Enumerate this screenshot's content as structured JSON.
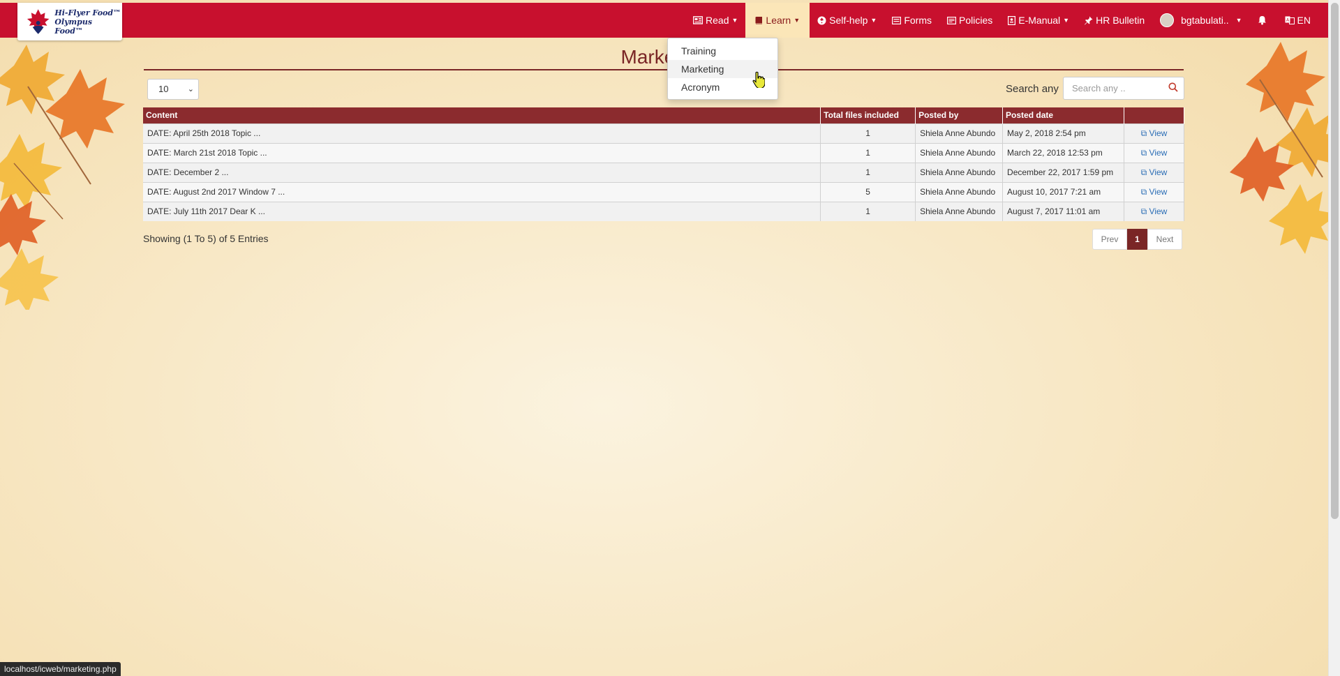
{
  "brand": {
    "line1": "Hi-Flyer Food™",
    "line2": "Olympus Food™"
  },
  "nav": {
    "read": "Read",
    "learn": "Learn",
    "selfhelp": "Self-help",
    "forms": "Forms",
    "policies": "Policies",
    "emanual": "E-Manual",
    "hrbulletin": "HR Bulletin",
    "user": "bgtabulati..",
    "lang": "EN"
  },
  "dropdown": {
    "items": [
      "Training",
      "Marketing",
      "Acronym"
    ]
  },
  "page": {
    "title": "Marketing"
  },
  "controls": {
    "page_length": "10",
    "search_label": "Search any",
    "search_placeholder": "Search any .."
  },
  "table": {
    "headers": [
      "Content",
      "Total files included",
      "Posted by",
      "Posted date",
      ""
    ],
    "rows": [
      {
        "content": "DATE: April 25th 2018   Topic ...",
        "files": "1",
        "by": "Shiela Anne Abundo",
        "date": "May 2, 2018 2:54 pm",
        "action": "View"
      },
      {
        "content": "DATE: March 21st 2018   Topic ...",
        "files": "1",
        "by": "Shiela Anne Abundo",
        "date": "March 22, 2018 12:53 pm",
        "action": "View"
      },
      {
        "content": "DATE:  December 2 ...",
        "files": "1",
        "by": "Shiela Anne Abundo",
        "date": "December 22, 2017 1:59 pm",
        "action": "View"
      },
      {
        "content": "DATE: August 2nd 2017  Window 7 ...",
        "files": "5",
        "by": "Shiela Anne Abundo",
        "date": "August 10, 2017 7:21 am",
        "action": "View"
      },
      {
        "content": "DATE: July 11th 2017   Dear K ...",
        "files": "1",
        "by": "Shiela Anne Abundo",
        "date": "August 7, 2017 11:01 am",
        "action": "View"
      }
    ]
  },
  "info": "Showing (1 To 5) of 5 Entries",
  "pager": {
    "prev": "Prev",
    "current": "1",
    "next": "Next"
  },
  "statusbar": "localhost/icweb/marketing.php",
  "colors": {
    "navbar": "#c8102e",
    "header": "#8b2b2e",
    "title": "#7a2626",
    "link": "#2a6db5"
  }
}
